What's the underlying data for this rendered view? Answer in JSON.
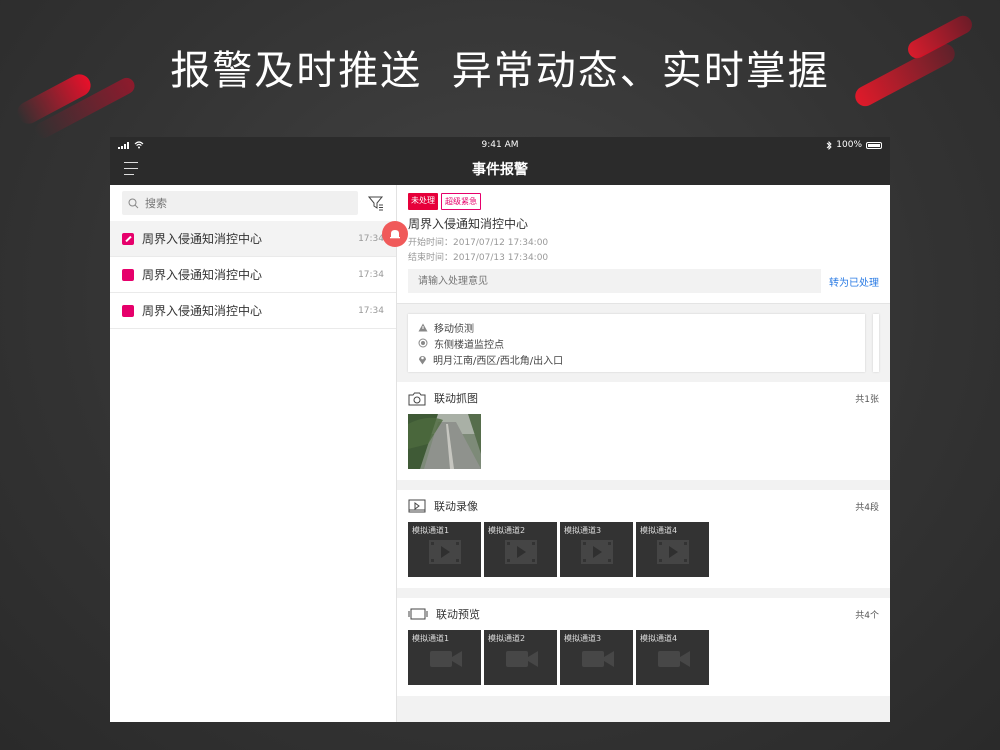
{
  "banner": {
    "headline": "报警及时推送  异常动态、实时掌握"
  },
  "status_bar": {
    "time": "9:41 AM",
    "battery": "100%"
  },
  "nav": {
    "title": "事件报警",
    "menu_icon": "hamburger-icon"
  },
  "search": {
    "placeholder": "搜索"
  },
  "events": [
    {
      "title": "周界入侵通知消控中心",
      "time": "17:34",
      "icon": "edit-square-icon"
    },
    {
      "title": "周界入侵通知消控中心",
      "time": "17:34",
      "icon": "square-icon"
    },
    {
      "title": "周界入侵通知消控中心",
      "time": "17:34",
      "icon": "square-icon"
    }
  ],
  "detail": {
    "status_tag": "未处理",
    "level_tag": "超级紧急",
    "title": "周界入侵通知消控中心",
    "start_time": "开始时间：2017/07/12 17:34:00",
    "end_time": "结束时间：2017/07/13 17:34:00",
    "opinion_placeholder": "请输入处理意见",
    "handle_button": "转为已处理"
  },
  "info": {
    "type": "移动侦测",
    "point": "东侧楼道监控点",
    "location": "明月江南/西区/西北角/出入口"
  },
  "snapshots": {
    "title": "联动抓图",
    "count": "共1张"
  },
  "recordings": {
    "title": "联动录像",
    "count": "共4段",
    "channels": [
      "模拟通道1",
      "模拟通道2",
      "模拟通道3",
      "模拟通道4"
    ]
  },
  "previews": {
    "title": "联动预览",
    "count": "共4个",
    "channels": [
      "模拟通道1",
      "模拟通道2",
      "模拟通道3",
      "模拟通道4"
    ]
  },
  "colors": {
    "accent_pink": "#e6006b",
    "tag_red": "#e6003a",
    "link_blue": "#2a7be4",
    "alarm_fab": "#f05a5a",
    "bar_dark": "#2b2b2b"
  }
}
